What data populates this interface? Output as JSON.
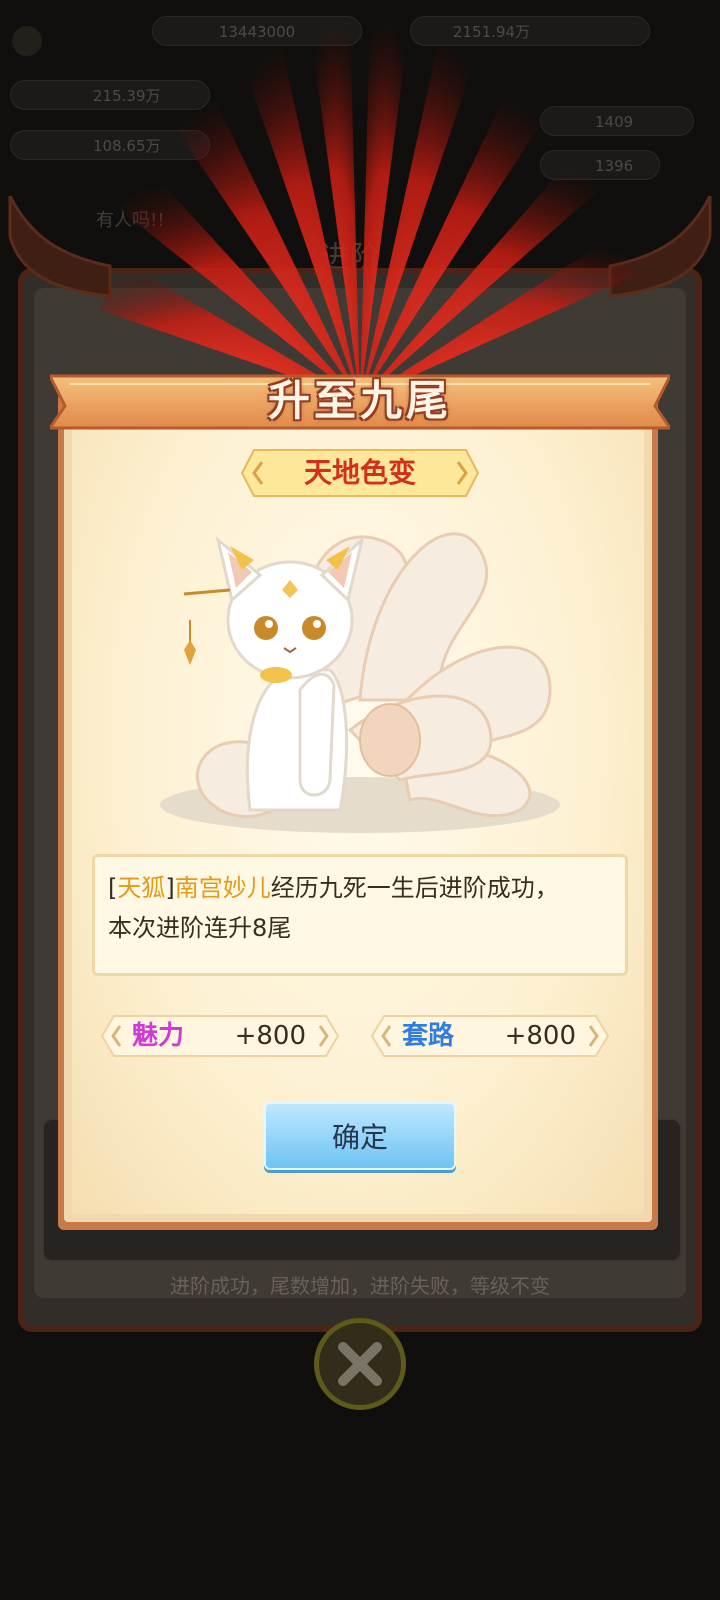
{
  "hud": {
    "top_value_1": "13443000",
    "top_value_2": "2151.94万",
    "stat_row_1": "215.39万",
    "stat_row_2": "108.65万",
    "side_value_1": "1409",
    "side_value_2": "1396",
    "chat_hint": "有人吗!!"
  },
  "back_panel": {
    "tab_label": "进阶",
    "footer_hint": "进阶成功，尾数增加，进阶失败，等级不变"
  },
  "modal": {
    "banner_title": "升至九尾",
    "subtitle": "天地色变",
    "desc_bracket_open": "[",
    "desc_rank": "天狐",
    "desc_bracket_close": "]",
    "desc_name": "南宫妙儿",
    "desc_line1_rest": "经历九死一生后进阶成功，",
    "desc_line2": "本次进阶连升8尾",
    "stats": [
      {
        "label": "魅力",
        "value": "+800",
        "color": "#cf3bd4"
      },
      {
        "label": "套路",
        "value": "+800",
        "color": "#2f7de0"
      }
    ],
    "confirm_label": "确定"
  },
  "colors": {
    "frame": "#c97a4a",
    "paper": "#fdf0d0",
    "accent_red": "#d2301c",
    "gold_text": "#e39a18",
    "button_blue": "#6ec3f4"
  }
}
